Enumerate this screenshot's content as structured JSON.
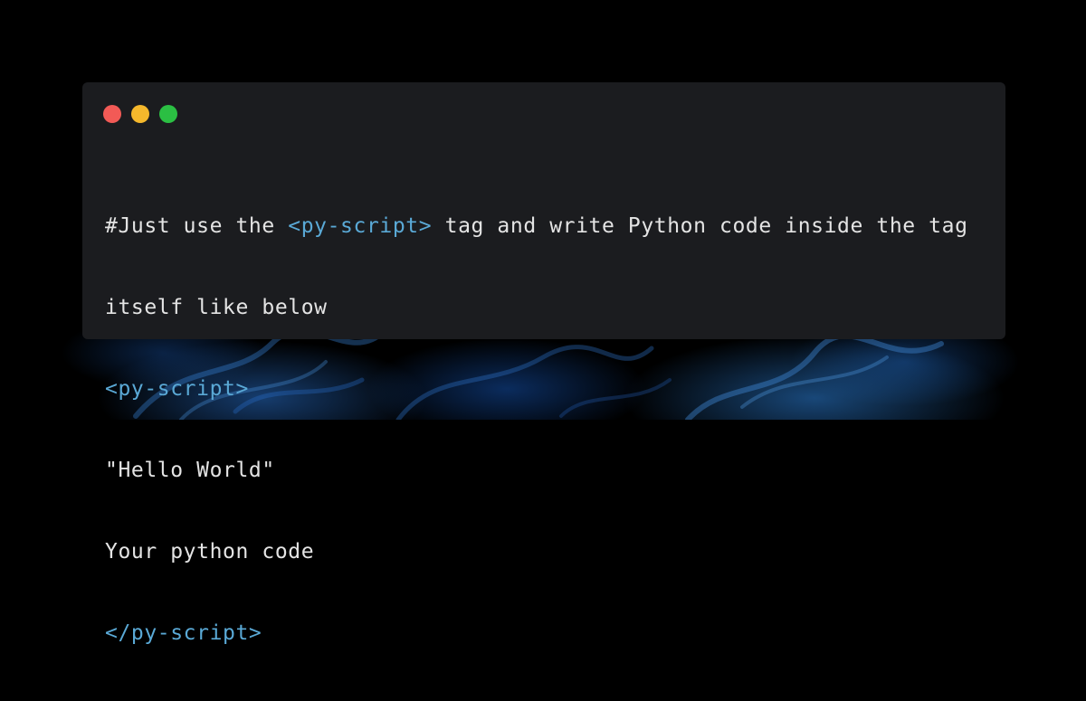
{
  "window": {
    "controls": [
      {
        "name": "close-button",
        "color": "#f25a56"
      },
      {
        "name": "minimize-button",
        "color": "#f5b82c"
      },
      {
        "name": "maximize-button",
        "color": "#2bbf43"
      }
    ]
  },
  "code": {
    "line1": {
      "before": "#Just use the ",
      "tag": "<py-script>",
      "after": " tag and write Python code inside the tag"
    },
    "line2": "itself like below",
    "line3": "<py-script>",
    "line4": "\"Hello World\"",
    "line5": "Your python code",
    "line6": "</py-script>"
  },
  "colors": {
    "window_bg": "#1b1c1f",
    "text": "#e4e4e4",
    "tag": "#5aa9d6"
  }
}
